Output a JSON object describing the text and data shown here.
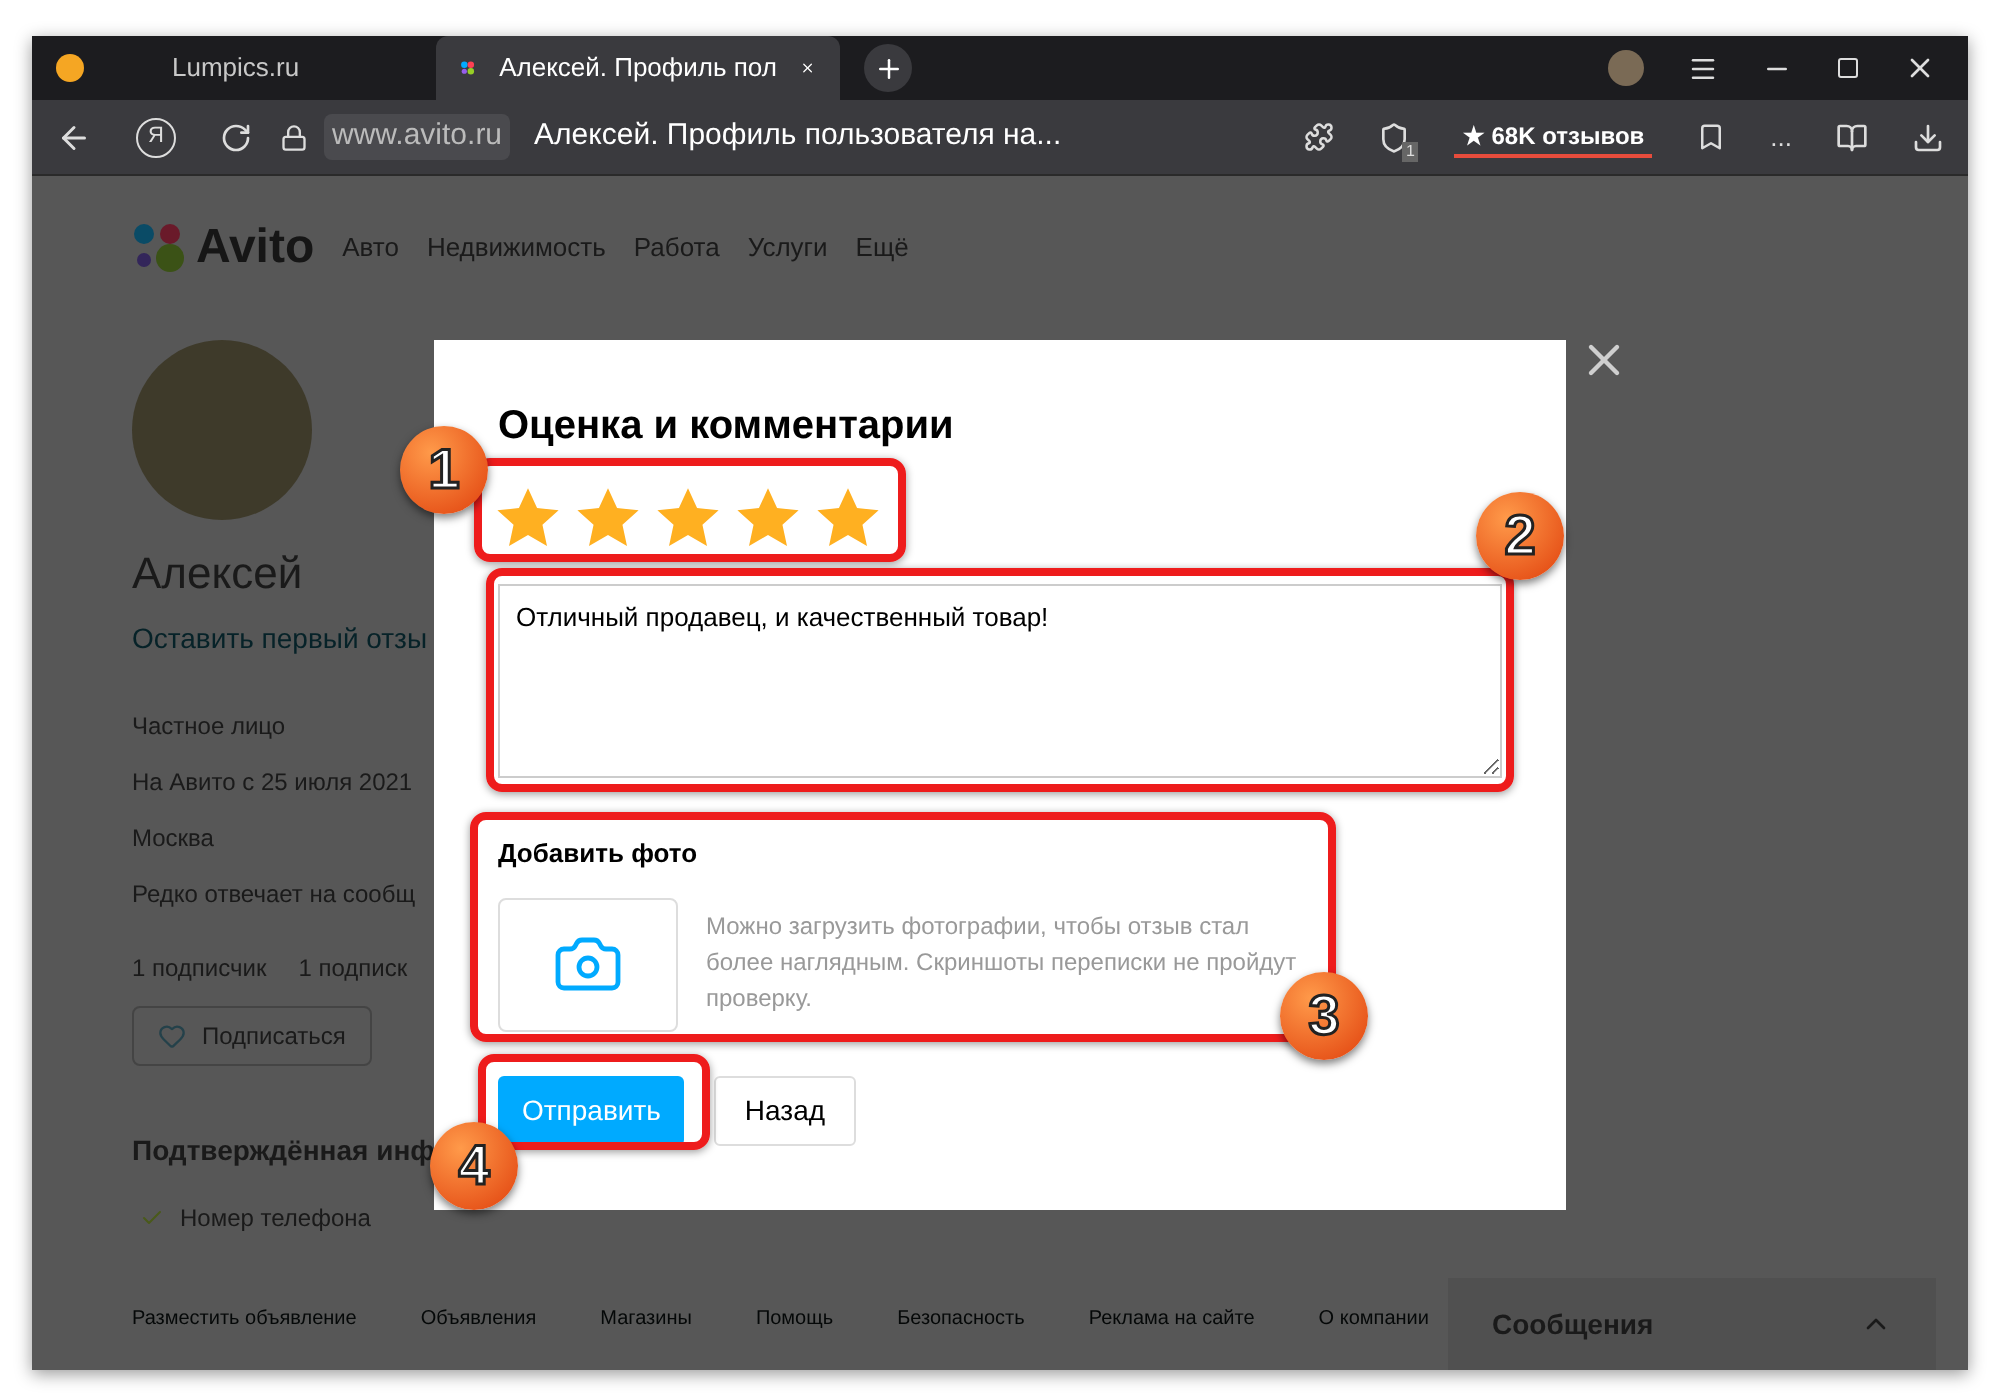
{
  "browser": {
    "tabs": [
      {
        "title": "Lumpics.ru",
        "selected": false
      },
      {
        "title": "Алексей. Профиль пол",
        "selected": true
      }
    ],
    "yandex_button": "Я",
    "domain": "www.avito.ru",
    "page_title": "Алексей. Профиль пользователя на...",
    "extension_badge": "1",
    "reviews": "★ 68K отзывов",
    "more": "..."
  },
  "page": {
    "logo": "Avito",
    "nav": [
      "Авто",
      "Недвижимость",
      "Работа",
      "Услуги",
      "Ещё"
    ],
    "profile": {
      "name": "Алексей",
      "review_link": "Оставить первый отзы",
      "info": [
        "Частное лицо",
        "На Авито с 25 июля 2021",
        "Москва",
        "Редко отвечает на сообщ"
      ],
      "subscribers": [
        "1 подписчик",
        "1 подписк"
      ],
      "subscribe_button": "Подписаться",
      "verified_heading": "Подтверждённая инф",
      "verified_items": [
        "Номер телефона"
      ]
    },
    "footer_links": [
      "Разместить объявление",
      "Объявления",
      "Магазины",
      "Помощь",
      "Безопасность",
      "Реклама на сайте",
      "О компании"
    ],
    "messages_panel": {
      "title": "Сообщения",
      "expanded": false
    }
  },
  "modal": {
    "title": "Оценка и комментарии",
    "stars": 5,
    "comment": "Отличный продавец, и качественный товар!",
    "photo_title": "Добавить фото",
    "photo_hint": "Можно загрузить фотографии, чтобы отзыв стал более наглядным. Скриншоты переписки не пройдут проверку.",
    "buttons": [
      {
        "label": "Отправить",
        "kind": "primary"
      },
      {
        "label": "Назад",
        "kind": "secondary"
      }
    ]
  },
  "annotations": [
    "1",
    "2",
    "3",
    "4"
  ]
}
